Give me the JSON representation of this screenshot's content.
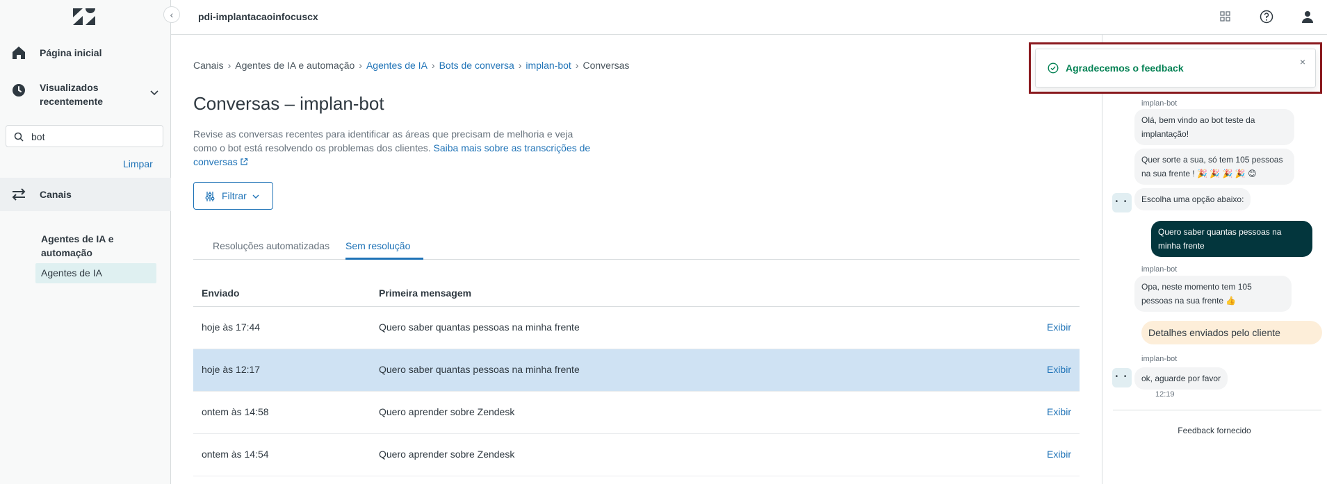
{
  "sidebar": {
    "home_label": "Página inicial",
    "recent_label": "Visualizados recentemente",
    "search_value": "bot",
    "clear_label": "Limpar",
    "channels_label": "Canais",
    "section_heading": "Agentes de IA e automação",
    "section_item": "Agentes de IA"
  },
  "header": {
    "account_name": "pdi-implantacaoinfocuscx"
  },
  "breadcrumb": [
    {
      "label": "Canais"
    },
    {
      "label": "Agentes de IA e automação"
    },
    {
      "label": "Agentes de IA"
    },
    {
      "label": "Bots de conversa"
    },
    {
      "label": "implan-bot"
    },
    {
      "label": "Conversas"
    }
  ],
  "main": {
    "title": "Conversas – implan-bot",
    "description": "Revise as conversas recentes para identificar as áreas que precisam de melhoria e veja como o bot está resolvendo os problemas dos clientes.",
    "learn_more": "Saiba mais sobre as transcrições de conversas",
    "filter_label": "Filtrar",
    "tabs": [
      {
        "label": "Resoluções automatizadas"
      },
      {
        "label": "Sem resolução"
      }
    ],
    "table": {
      "headers": [
        "Enviado",
        "Primeira mensagem"
      ],
      "rows": [
        {
          "sent": "hoje às 17:44",
          "first": "Quero saber quantas pessoas na minha frente",
          "action": "Exibir"
        },
        {
          "sent": "hoje às 12:17",
          "first": "Quero saber quantas pessoas na minha frente",
          "action": "Exibir"
        },
        {
          "sent": "ontem às 14:58",
          "first": "Quero aprender sobre Zendesk",
          "action": "Exibir"
        },
        {
          "sent": "ontem às 14:54",
          "first": "Quero aprender sobre Zendesk",
          "action": "Exibir"
        }
      ]
    }
  },
  "toast": {
    "text": "Agradecemos o feedback",
    "close": "×"
  },
  "conversation": {
    "bot_name": "implan-bot",
    "msg1": "Olá, bem vindo ao bot teste da implantação!",
    "msg2": "Quer sorte a sua, só tem 105 pessoas na sua frente ! 🎉 🎉 🎉 🎉 😊",
    "msg3": "Escolha uma opção abaixo:",
    "user_msg": "Quero saber quantas pessoas na minha frente",
    "msg4": "Opa, neste momento tem 105 pessoas na sua frente 👍",
    "details": "Detalhes enviados pelo cliente",
    "msg5": "ok, aguarde por favor",
    "time": "12:19",
    "avatar": "• •",
    "feedback_given": "Feedback fornecido"
  }
}
